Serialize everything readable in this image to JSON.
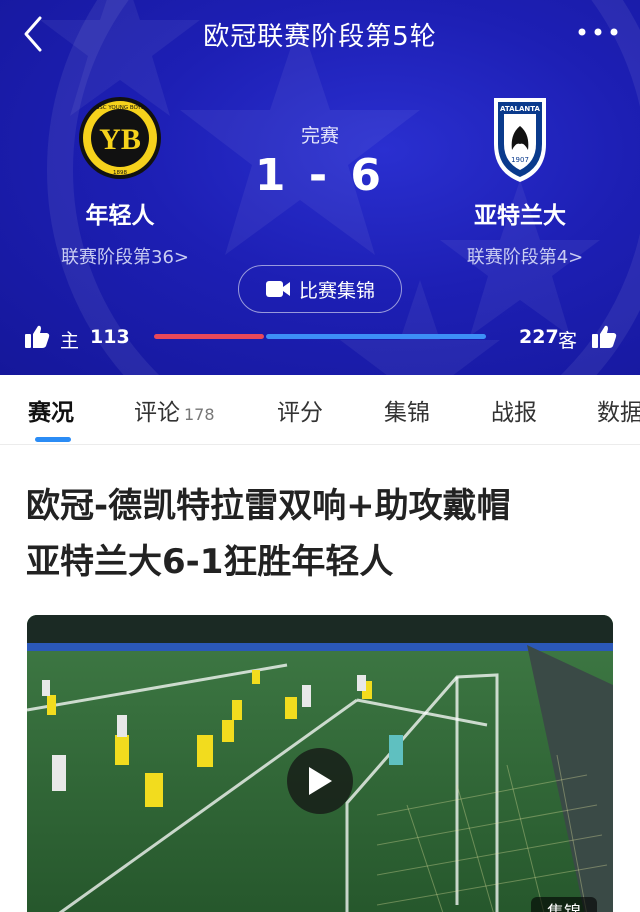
{
  "header": {
    "title": "欧冠联赛阶段第5轮",
    "status": "完赛",
    "score": "1 - 6",
    "home": {
      "name": "年轻人",
      "rank": "联赛阶段第36>",
      "crest_text": "BSC YOUNG BOYS",
      "crest_year": "1898"
    },
    "away": {
      "name": "亚特兰大",
      "rank": "联赛阶段第4>",
      "crest_text": "ATALANTA",
      "crest_year": "1907"
    },
    "highlight_label": "比赛集锦",
    "votes": {
      "home_label": "主",
      "home_count": "113",
      "away_label": "客",
      "away_count": "227",
      "home_share": 0.332,
      "home_color": "#e8485a",
      "away_color": "#3d8ff7"
    }
  },
  "tabs": [
    {
      "label": "赛况",
      "active": true
    },
    {
      "label": "评论",
      "count": "178"
    },
    {
      "label": "评分"
    },
    {
      "label": "集锦"
    },
    {
      "label": "战报"
    },
    {
      "label": "数据"
    }
  ],
  "article": {
    "headline_line1": "欧冠-德凯特拉雷双响+助攻戴帽",
    "headline_line2": "亚特兰大6-1狂胜年轻人",
    "video_tag": "集锦"
  },
  "colors": {
    "header_bg": "#1d1fb4",
    "tab_indicator": "#2b8cf5",
    "home_crest": "#f6d21c"
  },
  "icons": [
    "back-arrow-icon",
    "more-icon",
    "video-icon",
    "thumbs-up-icon",
    "play-icon"
  ]
}
